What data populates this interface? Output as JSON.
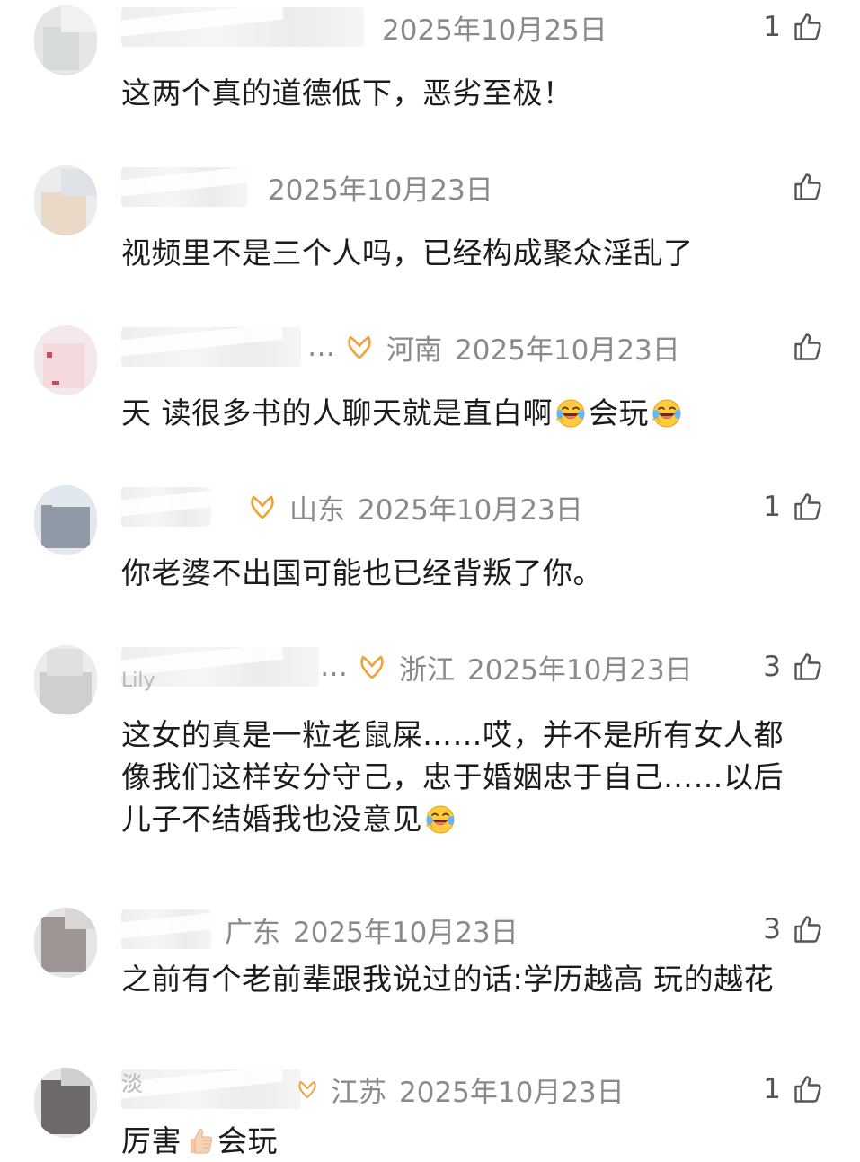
{
  "comments": [
    {
      "region": "",
      "date": "2025年10月25日",
      "likes": "1",
      "text": "这两个真的道德低下，恶劣至极！"
    },
    {
      "region": "",
      "date": "2025年10月23日",
      "likes": "",
      "text": "视频里不是三个人吗，已经构成聚众淫乱了"
    },
    {
      "region": "河南",
      "date": "2025年10月23日",
      "likes": "",
      "text_parts": [
        "天 读很多书的人聊天就是直白啊",
        "会玩"
      ],
      "emoji": "laughing-crying-emoji"
    },
    {
      "region": "山东",
      "date": "2025年10月23日",
      "likes": "1",
      "text": "你老婆不出国可能也已经背叛了你。"
    },
    {
      "region": "浙江",
      "date": "2025年10月23日",
      "likes": "3",
      "lines": [
        "这女的真是一粒老鼠屎……哎，并不是所有女人都",
        "像我们这样安分守己，忠于婚姻忠于自己……以后",
        "儿子不结婚我也没意见"
      ],
      "emoji": "laughing-crying-emoji"
    },
    {
      "region": "广东",
      "date": "2025年10月23日",
      "likes": "3",
      "text": "之前有个老前辈跟我说过的话:学历越高 玩的越花"
    },
    {
      "region": "江苏",
      "date": "2025年10月23日",
      "likes": "1",
      "text_parts": [
        "厉害",
        "会玩"
      ],
      "emoji": "thumbs-up-emoji"
    }
  ],
  "name_fragments": {
    "c5": "Lily",
    "c7": "淡"
  },
  "ellipsis": "…",
  "colors": {
    "meta_text": "#8a8a8a",
    "body_text": "#1c1c1c",
    "badge_orange": "#f0a23a",
    "like_icon": "#555555"
  },
  "icons": {
    "badge": "fan-badge-icon",
    "like": "thumbs-up-outline-icon"
  }
}
